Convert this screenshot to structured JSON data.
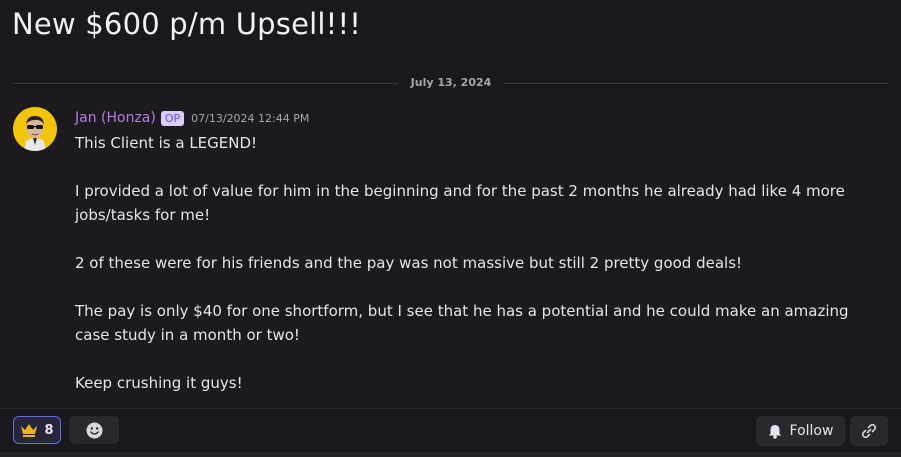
{
  "thread": {
    "title": "New $600 p/m Upsell!!!"
  },
  "divider": {
    "date": "July 13, 2024"
  },
  "message": {
    "author": "Jan (Honza)",
    "badge": "OP",
    "timestamp": "07/13/2024 12:44 PM",
    "avatar_icon": "avatar-sunglasses-icon",
    "paragraphs": [
      "This Client is a LEGEND!",
      "I provided a lot of value for him in the beginning and for the past 2 months he already had like 4 more jobs/tasks for me!",
      "2 of these were for his friends and the pay was not massive but still 2 pretty good deals!",
      "The pay is only $40 for one shortform, but I see that he has a potential and he could make an amazing case study in a month or two!",
      "Keep crushing it guys!"
    ]
  },
  "footer": {
    "reaction": {
      "icon": "crown-icon",
      "count": "8"
    },
    "add_reaction_icon": "smiley-icon",
    "follow_label": "Follow",
    "follow_icon": "bell-icon",
    "link_icon": "link-icon"
  },
  "colors": {
    "background": "#1a181d",
    "author": "#b57edc",
    "accent": "#5b6fe0",
    "crown": "#f0b020"
  }
}
